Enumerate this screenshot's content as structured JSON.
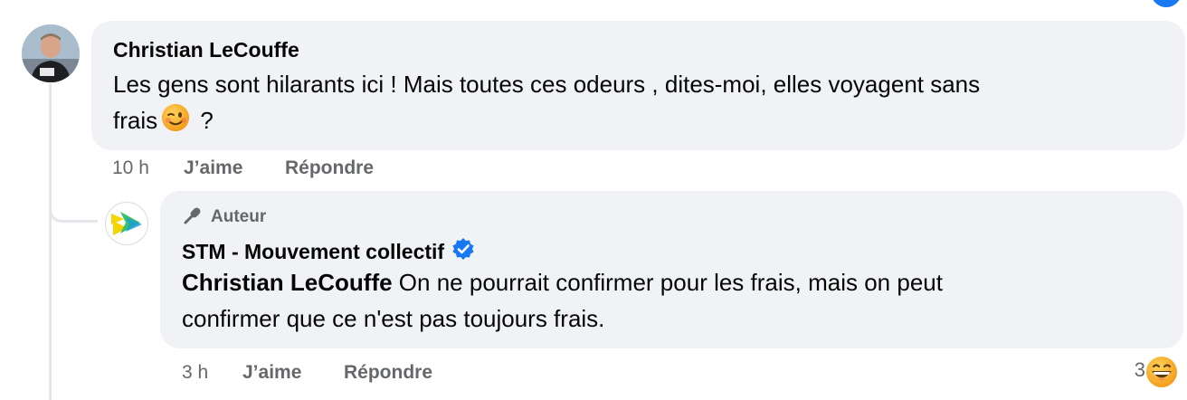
{
  "comment": {
    "author": "Christian LeCouffe",
    "text_line1": "Les gens sont hilarants ici ! Mais toutes ces odeurs , dites-moi, elles voyagent sans",
    "text_line2_prefix": "frais",
    "text_line2_suffix": " ?",
    "inline_emoji": "winking-face",
    "time": "10 h",
    "like_label": "J’aime",
    "reply_label": "Répondre"
  },
  "reply": {
    "badge_label": "Auteur",
    "author": "STM - Mouvement collectif",
    "verified": true,
    "mention": "Christian LeCouffe",
    "text_line1": " On ne pourrait confirmer pour les frais, mais on peut",
    "text_line2": "confirmer que ce n'est pas toujours frais.",
    "time": "3 h",
    "like_label": "J’aime",
    "reply_label": "Répondre",
    "reaction_count": "3",
    "reaction_emoji": "laughing-face"
  },
  "colors": {
    "bubble": "#f0f2f5",
    "meta_text": "#65676b",
    "verified": "#1877f2",
    "stm_yellow": "#f5d400",
    "stm_green": "#38c26a",
    "stm_blue": "#1e9bd7"
  }
}
